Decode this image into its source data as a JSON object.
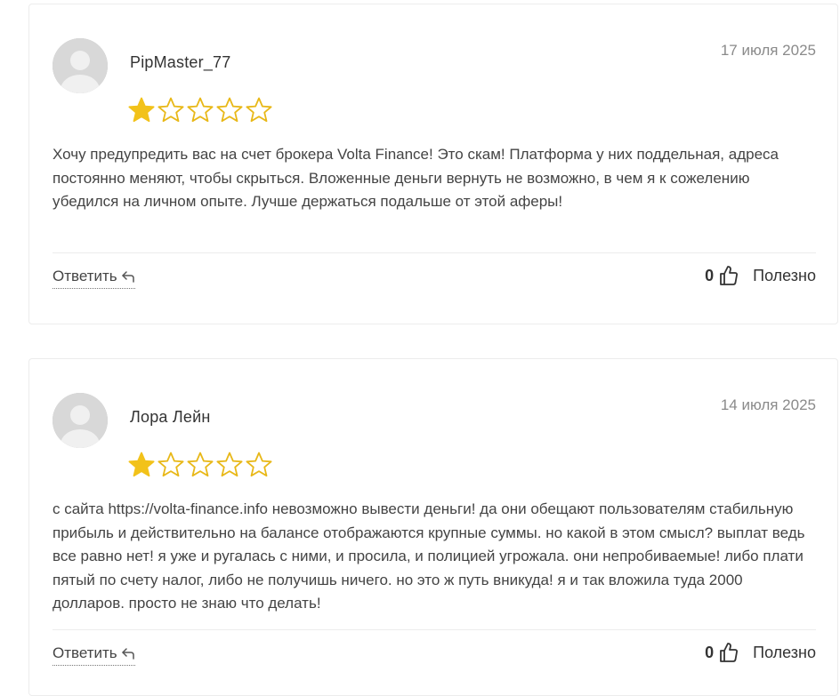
{
  "reviews": [
    {
      "author": "PipMaster_77",
      "date": "17 июля 2025",
      "rating": 1,
      "rating_max": 5,
      "text": "Хочу предупредить вас на счет брокера Volta Finance! Это скам! Платформа у них поддельная, адреса постоянно меняют, чтобы скрыться. Вложенные деньги вернуть не возможно, в чем я к сожелению убедился на личном опыте. Лучше держаться подальше от этой аферы!",
      "reply_label": "Ответить",
      "helpful_count": "0",
      "helpful_label": "Полезно"
    },
    {
      "author": "Лора Лейн",
      "date": "14 июля 2025",
      "rating": 1,
      "rating_max": 5,
      "text": "с сайта https://volta-finance.info невозможно вывести деньги! да они обещают пользователям стабильную прибыль и действительно на балансе отображаются крупные суммы. но какой в этом смысл? выплат ведь все равно нет! я уже и ругалась с ними, и просила, и полицией угрожала. они непробиваемые! либо плати пятый по счету налог, либо не получишь ничего. но это ж путь вникуда! я и так вложила туда 2000 долларов. просто не знаю что делать!",
      "reply_label": "Ответить",
      "helpful_count": "0",
      "helpful_label": "Полезно"
    }
  ],
  "icons": {
    "avatar": "user-avatar-placeholder",
    "star_filled": "star-filled-icon",
    "star_empty": "star-outline-icon",
    "reply": "reply-arrow-icon",
    "thumb": "thumbs-up-icon"
  },
  "colors": {
    "star": "#F2C21A",
    "star_outline": "#E8B818",
    "date": "#8A8A8A",
    "border": "#ECECEC"
  }
}
